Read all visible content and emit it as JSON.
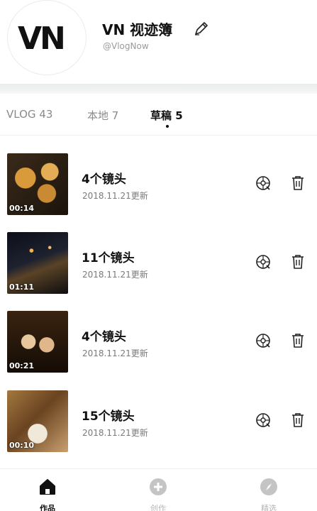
{
  "profile": {
    "avatar_text": "VN",
    "name": "VN 视迹簿",
    "handle": "@VlogNow"
  },
  "tabs": [
    {
      "label": "VLOG 43",
      "active": false
    },
    {
      "label": "本地 7",
      "active": false
    },
    {
      "label": "草稿 5",
      "active": true
    }
  ],
  "drafts": [
    {
      "duration": "00:14",
      "clips": "4个镜头",
      "updated": "2018.11.21更新"
    },
    {
      "duration": "01:11",
      "clips": "11个镜头",
      "updated": "2018.11.21更新"
    },
    {
      "duration": "00:21",
      "clips": "4个镜头",
      "updated": "2018.11.21更新"
    },
    {
      "duration": "00:10",
      "clips": "15个镜头",
      "updated": "2018.11.21更新"
    }
  ],
  "bottom_nav": [
    {
      "label": "作品",
      "icon": "home-icon",
      "active": true
    },
    {
      "label": "创作",
      "icon": "plus-circle-icon",
      "active": false
    },
    {
      "label": "精选",
      "icon": "compass-icon",
      "active": false
    }
  ],
  "colors": {
    "text": "#111111",
    "muted": "#8a8a8a",
    "inactive_nav": "#b5b5b5"
  }
}
